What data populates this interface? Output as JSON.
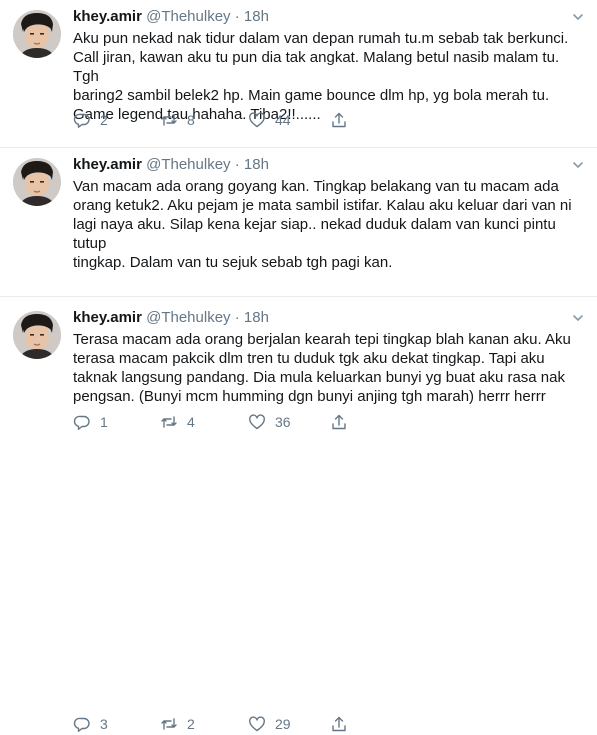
{
  "tweets": [
    {
      "name": "khey.amir",
      "handle": "@Thehulkey",
      "dot": "·",
      "time": "18h",
      "text": "Aku pun nekad nak tidur dalam van depan rumah tu.m sebab tak berkunci.\nCall jiran, kawan aku tu pun dia tak angkat. Malang betul nasib malam tu. Tgh\nbaring2 sambil belek2 hp. Main game bounce dlm hp, yg bola merah tu.\nGame legend tau hahaha. Tiba2!!......",
      "replies": "2",
      "retweets": "8",
      "likes": "44"
    },
    {
      "name": "khey.amir",
      "handle": "@Thehulkey",
      "dot": "·",
      "time": "18h",
      "text": "Van macam ada orang goyang kan. Tingkap belakang van tu macam ada\norang ketuk2. Aku pejam je mata sambil istifar. Kalau aku keluar dari van ni\nlagi naya aku. Silap kena kejar siap.. nekad duduk dalam van kunci pintu tutup\ntingkap. Dalam van tu sejuk sebab tgh pagi kan.",
      "replies": "1",
      "retweets": "4",
      "likes": "36"
    },
    {
      "name": "khey.amir",
      "handle": "@Thehulkey",
      "dot": "·",
      "time": "18h",
      "text": "Terasa macam ada orang berjalan kearah tepi tingkap blah kanan aku. Aku\nterasa macam pakcik dlm tren tu duduk tgk aku dekat tingkap. Tapi aku\ntaknak langsung pandang. Dia mula keluarkan bunyi yg buat aku rasa nak\npengsan. (Bunyi mcm humming dgn bunyi anjing tgh marah) herrr herrr",
      "replies": "3",
      "retweets": "2",
      "likes": "29"
    }
  ],
  "icons": {
    "avatar": "avatar-photo",
    "caret": "chevron-down-icon",
    "reply": "reply-icon",
    "retweet": "retweet-icon",
    "like": "heart-icon",
    "share": "share-icon"
  },
  "colors": {
    "text": "#14171a",
    "muted": "#657786",
    "divider": "#e6ecf0",
    "background": "#ffffff"
  }
}
